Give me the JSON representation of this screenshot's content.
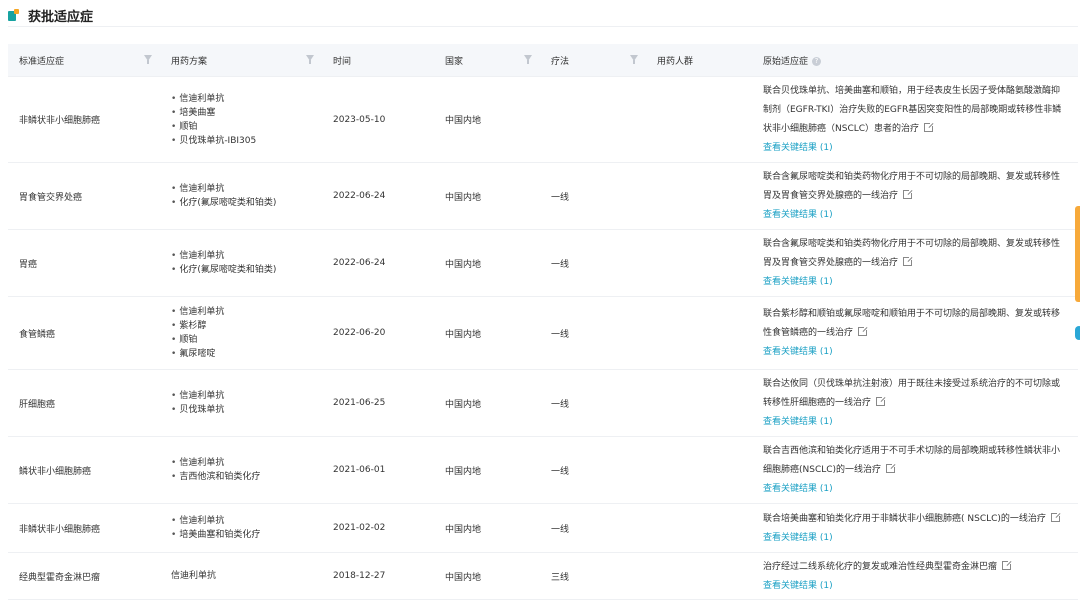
{
  "page": {
    "title": "获批适应症"
  },
  "columns": {
    "indication": "标准适应症",
    "regimen": "用药方案",
    "date": "时间",
    "country": "国家",
    "therapy": "疗法",
    "population": "用药人群",
    "original": "原始适应症"
  },
  "rows": [
    {
      "indication": "非鳞状非小细胞肺癌",
      "regimen": [
        "信迪利单抗",
        "培美曲塞",
        "顺铂",
        "贝伐珠单抗-IBI305"
      ],
      "date": "2023-05-10",
      "country": "中国内地",
      "therapy": "",
      "population": "",
      "original": "联合贝伐珠单抗、培美曲塞和顺铂，用于经表皮生长因子受体酪氨酸激酶抑制剂（EGFR-TKI）治疗失败的EGFR基因突变阳性的局部晚期或转移性非鳞状非小细胞肺癌（NSCLC）患者的治疗",
      "key_link": "查看关键结果 (1)"
    },
    {
      "indication": "胃食管交界处癌",
      "regimen": [
        "信迪利单抗",
        "化疗(氟尿嘧啶类和铂类)"
      ],
      "date": "2022-06-24",
      "country": "中国内地",
      "therapy": "一线",
      "population": "",
      "original": "联合含氟尿嘧啶类和铂类药物化疗用于不可切除的局部晚期、复发或转移性胃及胃食管交界处腺癌的一线治疗",
      "key_link": "查看关键结果 (1)"
    },
    {
      "indication": "胃癌",
      "regimen": [
        "信迪利单抗",
        "化疗(氟尿嘧啶类和铂类)"
      ],
      "date": "2022-06-24",
      "country": "中国内地",
      "therapy": "一线",
      "population": "",
      "original": "联合含氟尿嘧啶类和铂类药物化疗用于不可切除的局部晚期、复发或转移性胃及胃食管交界处腺癌的一线治疗",
      "key_link": "查看关键结果 (1)"
    },
    {
      "indication": "食管鳞癌",
      "regimen": [
        "信迪利单抗",
        "紫杉醇",
        "顺铂",
        "氟尿嘧啶"
      ],
      "date": "2022-06-20",
      "country": "中国内地",
      "therapy": "一线",
      "population": "",
      "original": "联合紫杉醇和顺铂或氟尿嘧啶和顺铂用于不可切除的局部晚期、复发或转移性食管鳞癌的一线治疗",
      "key_link": "查看关键结果 (1)"
    },
    {
      "indication": "肝细胞癌",
      "regimen": [
        "信迪利单抗",
        "贝伐珠单抗"
      ],
      "date": "2021-06-25",
      "country": "中国内地",
      "therapy": "一线",
      "population": "",
      "original": "联合达攸同（贝伐珠单抗注射液）用于既往未接受过系统治疗的不可切除或转移性肝细胞癌的一线治疗",
      "key_link": "查看关键结果 (1)"
    },
    {
      "indication": "鳞状非小细胞肺癌",
      "regimen": [
        "信迪利单抗",
        "吉西他滨和铂类化疗"
      ],
      "date": "2021-06-01",
      "country": "中国内地",
      "therapy": "一线",
      "population": "",
      "original": "联合吉西他滨和铂类化疗适用于不可手术切除的局部晚期或转移性鳞状非小细胞肺癌(NSCLC)的一线治疗",
      "key_link": "查看关键结果 (1)"
    },
    {
      "indication": "非鳞状非小细胞肺癌",
      "regimen": [
        "信迪利单抗",
        "培美曲塞和铂类化疗"
      ],
      "date": "2021-02-02",
      "country": "中国内地",
      "therapy": "一线",
      "population": "",
      "original": "联合培美曲塞和铂类化疗用于非鳞状非小细胞肺癌( NSCLC)的一线治疗",
      "key_link": "查看关键结果 (1)"
    },
    {
      "indication": "经典型霍奇金淋巴瘤",
      "regimen": [
        "信迪利单抗"
      ],
      "date": "2018-12-27",
      "country": "中国内地",
      "therapy": "三线",
      "population": "",
      "original": "治疗经过二线系统化疗的复发或难治性经典型霍奇金淋巴瘤",
      "key_link": "查看关键结果 (1)"
    }
  ]
}
